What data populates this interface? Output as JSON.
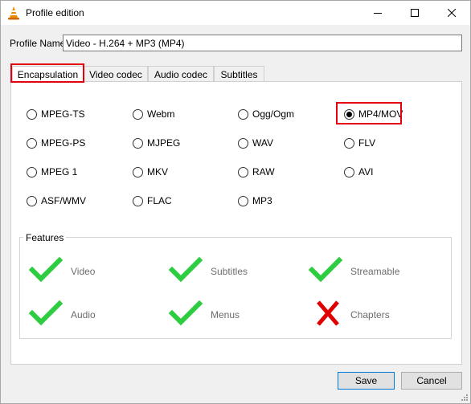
{
  "window": {
    "title": "Profile edition"
  },
  "profile": {
    "label": "Profile Name",
    "value": "Video - H.264 + MP3 (MP4)"
  },
  "tabs": [
    {
      "label": "Encapsulation",
      "active": true
    },
    {
      "label": "Video codec",
      "active": false
    },
    {
      "label": "Audio codec",
      "active": false
    },
    {
      "label": "Subtitles",
      "active": false
    }
  ],
  "encapsulation": {
    "selected": "MP4/MOV",
    "options": [
      "MPEG-TS",
      "Webm",
      "Ogg/Ogm",
      "MP4/MOV",
      "MPEG-PS",
      "MJPEG",
      "WAV",
      "FLV",
      "MPEG 1",
      "MKV",
      "RAW",
      "AVI",
      "ASF/WMV",
      "FLAC",
      "MP3"
    ]
  },
  "features": {
    "title": "Features",
    "items": [
      {
        "label": "Video",
        "supported": true
      },
      {
        "label": "Subtitles",
        "supported": true
      },
      {
        "label": "Streamable",
        "supported": true
      },
      {
        "label": "Audio",
        "supported": true
      },
      {
        "label": "Menus",
        "supported": true
      },
      {
        "label": "Chapters",
        "supported": false
      }
    ]
  },
  "buttons": {
    "save": "Save",
    "cancel": "Cancel"
  },
  "colors": {
    "check": "#2ecc40",
    "cross": "#e00000",
    "highlight": "#e4000f",
    "default_button_border": "#0078d7"
  },
  "icons": {
    "app": "vlc-cone-icon",
    "supported": "checkmark-icon",
    "unsupported": "cross-icon"
  }
}
